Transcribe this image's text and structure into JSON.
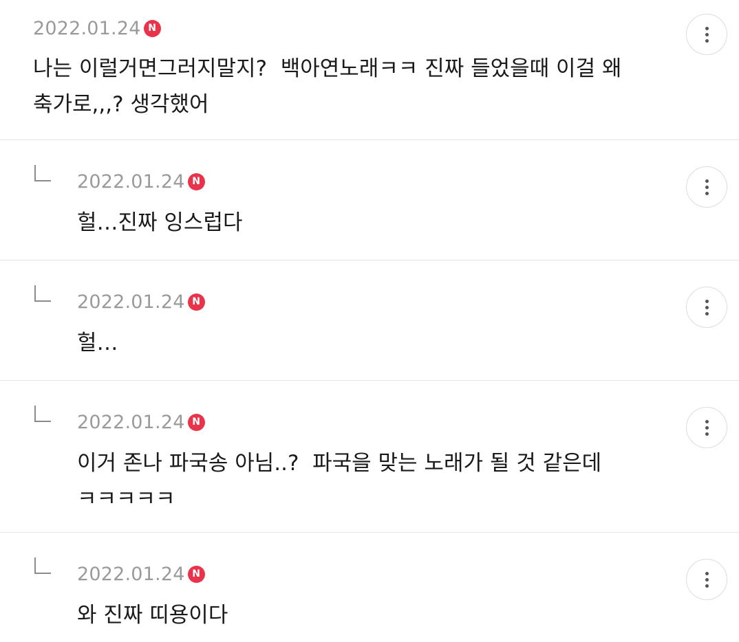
{
  "comments": [
    {
      "date": "2022.01.24",
      "badge": "N",
      "is_reply": false,
      "text": "나는 이럴거면그러지말지?  백아연노래ㅋㅋ 진짜 들었을때 이걸 왜\n축가로,,,? 생각했어"
    },
    {
      "date": "2022.01.24",
      "badge": "N",
      "is_reply": true,
      "text": "헐…진짜 잉스럽다"
    },
    {
      "date": "2022.01.24",
      "badge": "N",
      "is_reply": true,
      "text": "헐…"
    },
    {
      "date": "2022.01.24",
      "badge": "N",
      "is_reply": true,
      "text": "이거 존나 파국송 아님..?  파국을 맞는 노래가 될 것 같은데\nㅋㅋㅋㅋㅋ"
    },
    {
      "date": "2022.01.24",
      "badge": "N",
      "is_reply": true,
      "text": "와 진짜 띠용이다"
    }
  ],
  "icons": {
    "more": "more-vertical-icon",
    "reply": "reply-arrow-icon",
    "new": "new-badge-icon"
  },
  "colors": {
    "badge": "#e8334b",
    "date": "#9a9a9a",
    "text": "#1a1a1a",
    "divider": "#e3e3e3"
  }
}
